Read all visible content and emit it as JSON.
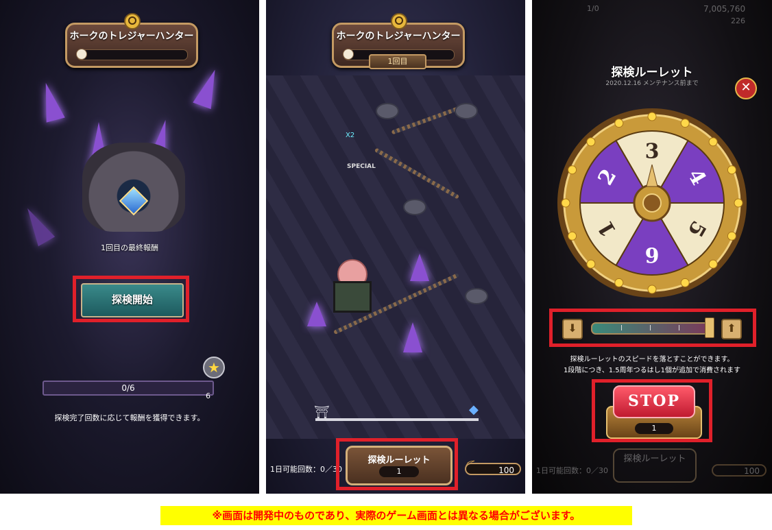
{
  "panel1": {
    "title": "ホークのトレジャーハンター",
    "cave_caption": "1回目の最終報酬",
    "start_button": "探検開始",
    "progress": "0/6",
    "progress_value": 0,
    "reward_count": "6",
    "note": "探検完了回数に応じて報酬を獲得できます。"
  },
  "panel2": {
    "title": "ホークのトレジャーハンター",
    "round_label": "1回目",
    "map_labels": {
      "multiplier": "X2",
      "special": "SPECIAL"
    },
    "roulette_button": "探検ルーレット",
    "roulette_cost": "1",
    "daily_label": "1日可能回数：0／30",
    "pickaxe_count": "100"
  },
  "panel3": {
    "title": "探検ルーレット",
    "top_value": "7,005,760",
    "top_value2": "226",
    "top_value3": "1/0",
    "maintenance_note": "2020.12.16 メンテナンス前まで",
    "wheel_numbers": [
      "3",
      "4",
      "5",
      "6",
      "1",
      "2"
    ],
    "wheel_colors": [
      "#f2e8c8",
      "#7a3fc0",
      "#f2e8c8",
      "#7a3fc0",
      "#f2e8c8",
      "#7a3fc0"
    ],
    "speed_level": 1.0,
    "desc_line1": "探検ルーレットのスピードを落とすことができます。",
    "desc_line2": "1段階につき、1.5周年つるはし1個が追加で消費されます",
    "stop_label": "STOP",
    "stop_cost": "1",
    "bg_button": "探検ルーレット",
    "bg_daily": "1日可能回数：0／30",
    "bg_pickaxe": "100"
  },
  "caption": "※画面は開発中のものであり、実際のゲーム画面とは異なる場合がございます。",
  "colors": {
    "highlight": "#e0202a",
    "caption_bg": "#ffff00",
    "caption_text": "#ff0000"
  }
}
